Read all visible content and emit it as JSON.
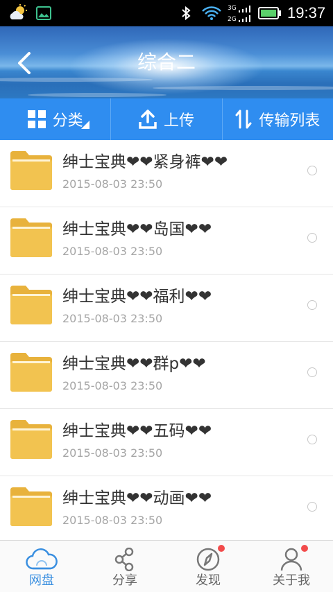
{
  "status_bar": {
    "time": "19:37",
    "network_3g": "3G",
    "network_2g": "2G",
    "icons": [
      "weather-icon",
      "gallery-icon",
      "bluetooth-icon",
      "wifi-icon",
      "signal-icon",
      "battery-icon"
    ]
  },
  "header": {
    "title": "综合二",
    "back_icon": "chevron-left-icon"
  },
  "toolbar": {
    "category_label": "分类",
    "upload_label": "上传",
    "transfer_label": "传输列表"
  },
  "files": [
    {
      "name": "绅士宝典❤❤紧身裤❤❤",
      "date": "2015-08-03  23:50"
    },
    {
      "name": "绅士宝典❤❤岛国❤❤",
      "date": "2015-08-03  23:50"
    },
    {
      "name": "绅士宝典❤❤福利❤❤",
      "date": "2015-08-03  23:50"
    },
    {
      "name": "绅士宝典❤❤群p❤❤",
      "date": "2015-08-03  23:50"
    },
    {
      "name": "绅士宝典❤❤五码❤❤",
      "date": "2015-08-03  23:50"
    },
    {
      "name": "绅士宝典❤❤动画❤❤",
      "date": "2015-08-03  23:50"
    }
  ],
  "bottom_nav": {
    "items": [
      {
        "label": "网盘",
        "icon": "cloud-icon",
        "active": true,
        "badge": false
      },
      {
        "label": "分享",
        "icon": "share-icon",
        "active": false,
        "badge": false
      },
      {
        "label": "发现",
        "icon": "compass-icon",
        "active": false,
        "badge": true
      },
      {
        "label": "关于我",
        "icon": "user-icon",
        "active": false,
        "badge": true
      }
    ]
  },
  "colors": {
    "accent": "#2f8df0",
    "folder": "#f2c14e",
    "badge": "#f24b4b",
    "active_nav": "#3a8fe0"
  }
}
